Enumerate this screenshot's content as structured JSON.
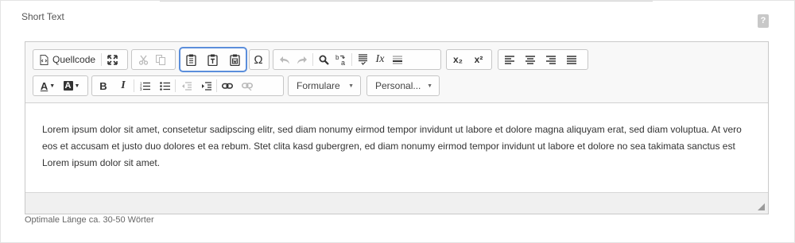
{
  "field": {
    "label": "Short Text",
    "help": "?",
    "hint": "Optimale Länge ca. 30-50 Wörter"
  },
  "toolbar": {
    "source_label": "Quellcode",
    "format_combo": "Formulare",
    "custom_combo": "Personal...",
    "icons": {
      "special_char": "Ω",
      "italic": "I",
      "bold": "B",
      "clear_format": "Ix",
      "subscript": "x₂",
      "superscript": "x²",
      "font_color": "A",
      "bg_color": "A"
    }
  },
  "content": {
    "text": "Lorem ipsum dolor sit amet, consetetur sadipscing elitr, sed diam nonumy eirmod tempor invidunt ut labore et dolore magna aliquyam erat, sed diam voluptua. At vero eos et accusam et justo duo dolores et ea rebum. Stet clita kasd gubergren, ed diam nonumy eirmod tempor invidunt ut labore et dolore no sea takimata sanctus est Lorem ipsum dolor sit amet."
  },
  "colors": {
    "highlight_border": "#5b8edb",
    "disabled_icon": "#b9b9b9"
  }
}
